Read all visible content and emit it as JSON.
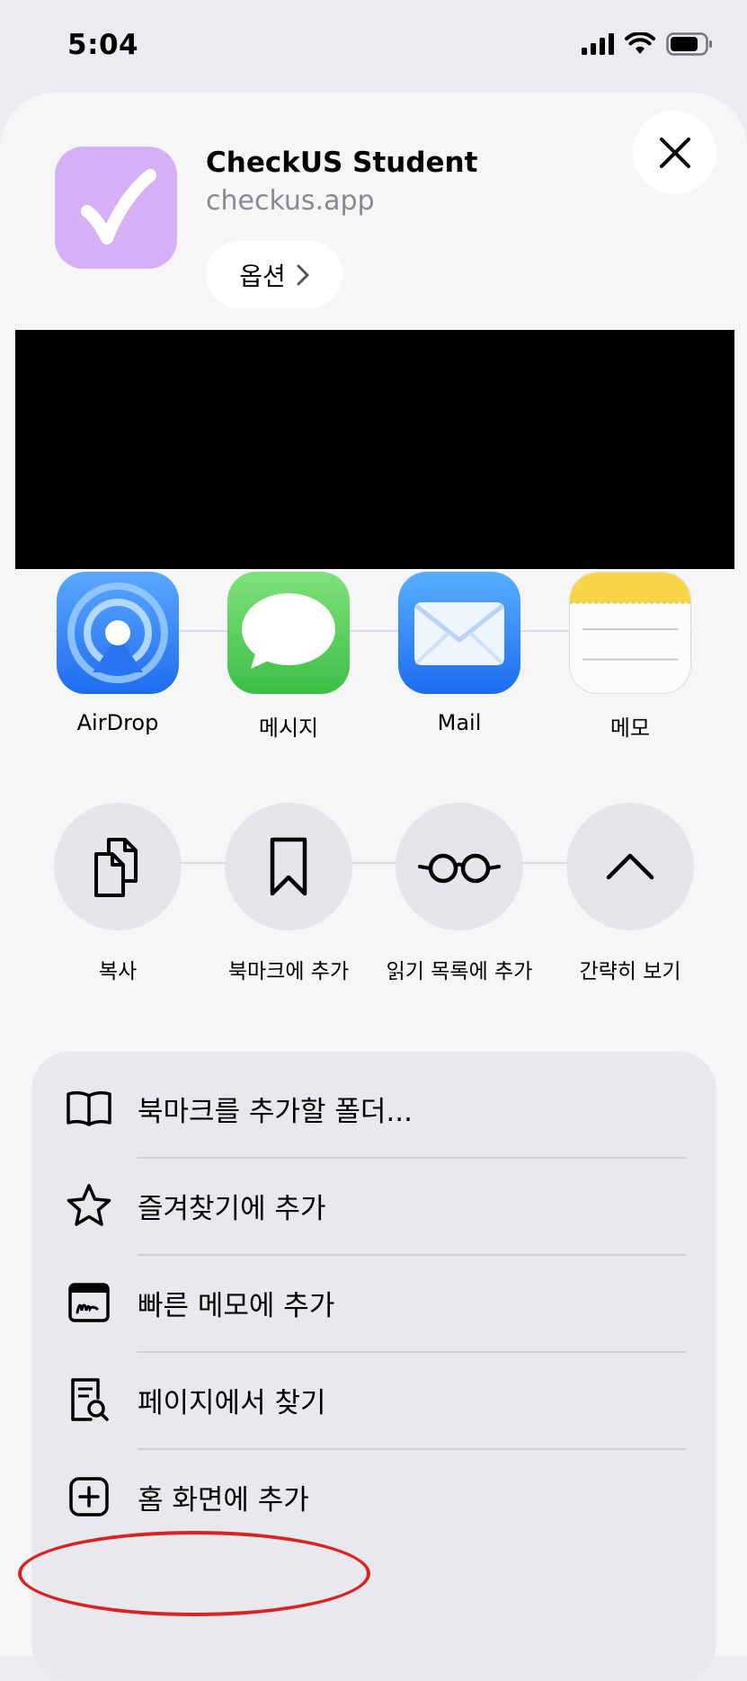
{
  "status_bar": {
    "time": "5:04"
  },
  "share_sheet": {
    "app_name": "CheckUS Student",
    "app_url": "checkus.app",
    "options_label": "옵션",
    "share_apps": [
      {
        "label": "AirDrop",
        "icon": "airdrop-icon"
      },
      {
        "label": "메시지",
        "icon": "messages-icon"
      },
      {
        "label": "Mail",
        "icon": "mail-icon"
      },
      {
        "label": "메모",
        "icon": "notes-icon"
      }
    ],
    "actions": [
      {
        "label": "복사",
        "icon": "copy-icon"
      },
      {
        "label": "북마크에 추가",
        "icon": "bookmark-icon"
      },
      {
        "label": "읽기 목록에 추가",
        "icon": "reading-list-icon"
      },
      {
        "label": "간략히 보기",
        "icon": "chevron-up-icon"
      }
    ],
    "menu_items": [
      {
        "label": "북마크를 추가할 폴더...",
        "icon": "book-icon"
      },
      {
        "label": "즐겨찾기에 추가",
        "icon": "star-icon"
      },
      {
        "label": "빠른 메모에 추가",
        "icon": "quick-note-icon"
      },
      {
        "label": "페이지에서 찾기",
        "icon": "find-in-page-icon"
      },
      {
        "label": "홈 화면에 추가",
        "icon": "add-square-icon"
      }
    ]
  },
  "colors": {
    "app_icon_bg": "#d6b0f6",
    "highlight": "#d92323"
  }
}
